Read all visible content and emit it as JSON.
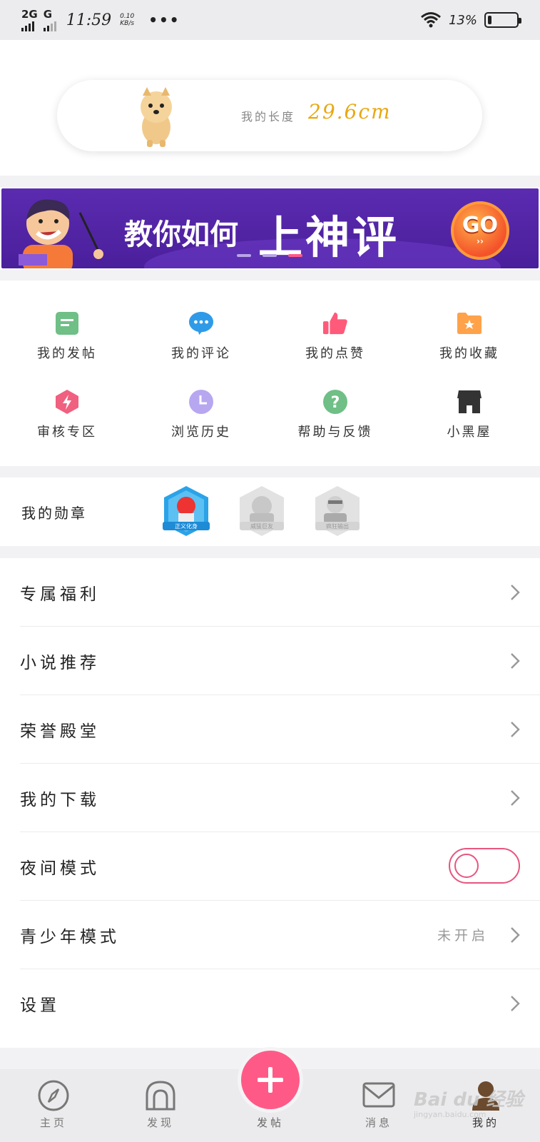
{
  "status_bar": {
    "network1": "2G",
    "network2": "G",
    "time": "11:59",
    "speed_value": "0.10",
    "speed_unit": "KB/s",
    "more": "•••",
    "battery_pct": "13%",
    "battery_level": 0.13
  },
  "profile": {
    "length_label": "我的长度",
    "length_value": "29.6cm"
  },
  "banner": {
    "text_small": "教你如何",
    "text_big": "上神评",
    "go_label": "GO",
    "go_sub": "››",
    "page_count": 3,
    "active_page": 3
  },
  "grid_menu": [
    {
      "label": "我的发帖",
      "icon": "post-list-icon",
      "color": "#6fbf86"
    },
    {
      "label": "我的评论",
      "icon": "comment-bubble-icon",
      "color": "#2f9be8"
    },
    {
      "label": "我的点赞",
      "icon": "thumbs-up-icon",
      "color": "#ff5a7a"
    },
    {
      "label": "我的收藏",
      "icon": "star-folder-icon",
      "color": "#ffa24a"
    },
    {
      "label": "审核专区",
      "icon": "lightning-hexagon-icon",
      "color": "#f0607f"
    },
    {
      "label": "浏览历史",
      "icon": "clock-icon",
      "color": "#b7a7f0"
    },
    {
      "label": "帮助与反馈",
      "icon": "question-icon",
      "color": "#6fbf86"
    },
    {
      "label": "小黑屋",
      "icon": "house-icon",
      "color": "#333333"
    }
  ],
  "medals": {
    "title": "我的勋章",
    "items": [
      {
        "name": "正义化身",
        "earned": true
      },
      {
        "name": "威猛巨友",
        "earned": false
      },
      {
        "name": "疯狂输出",
        "earned": false
      }
    ]
  },
  "list": [
    {
      "label": "专属福利",
      "type": "link"
    },
    {
      "label": "小说推荐",
      "type": "link"
    },
    {
      "label": "荣誉殿堂",
      "type": "link"
    },
    {
      "label": "我的下载",
      "type": "link"
    },
    {
      "label": "夜间模式",
      "type": "toggle",
      "on": false
    },
    {
      "label": "青少年模式",
      "type": "link",
      "value": "未开启"
    },
    {
      "label": "设置",
      "type": "link"
    }
  ],
  "bottom_nav": {
    "home": "主页",
    "discover": "发现",
    "post": "发帖",
    "messages": "消息",
    "mine": "我的"
  },
  "watermark": {
    "text": "Bai du 经验",
    "sub": "jingyan.baidu.com"
  },
  "colors": {
    "accent": "#ff5a87",
    "length_value": "#e8a812",
    "toggle": "#e8557e",
    "banner_bg": "#5b2bb0"
  }
}
